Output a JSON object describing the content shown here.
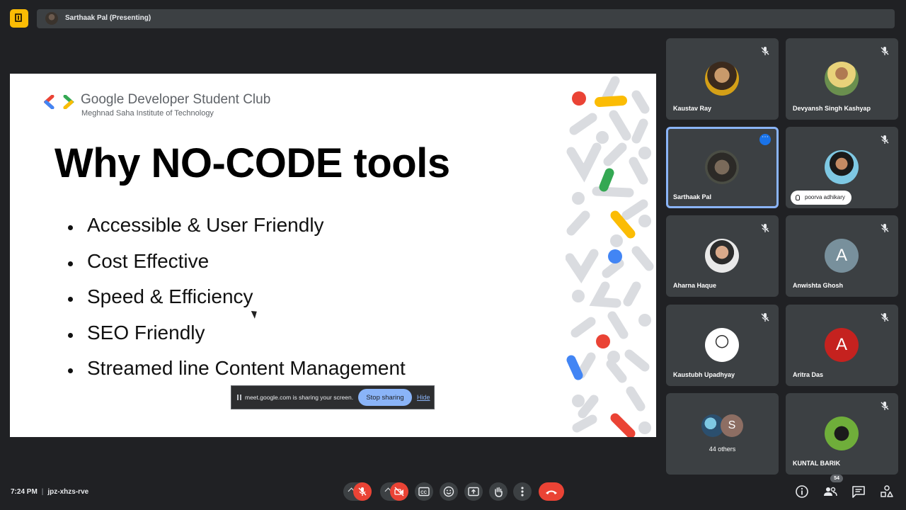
{
  "meeting": {
    "presenter_label": "Sarthaak Pal (Presenting)",
    "time": "7:24 PM",
    "separator": "|",
    "code": "jpz-xhzs-rve",
    "participant_count": "54"
  },
  "slide": {
    "org_name": "Google Developer Student Club",
    "org_institute": "Meghnad Saha Institute of Technology",
    "title": "Why NO-CODE tools",
    "bullets": [
      "Accessible & User Friendly",
      "Cost Effective",
      "Speed & Efficiency",
      "SEO Friendly",
      "Streamed line Content Management"
    ]
  },
  "share_bar": {
    "message": "meet.google.com is sharing your screen.",
    "stop_label": "Stop sharing",
    "hide_label": "Hide"
  },
  "participants": [
    {
      "name": "Kaustav Ray",
      "muted": true
    },
    {
      "name": "Devyansh Singh Kashyap",
      "muted": true
    },
    {
      "name": "Sarthaak Pal",
      "active": true
    },
    {
      "name": "poorva adhikary",
      "muted": true,
      "hand_raised": true
    },
    {
      "name": "Aharna Haque",
      "muted": true
    },
    {
      "name": "Anwishta Ghosh",
      "initial": "A",
      "avatar_color": "#78909c",
      "muted": true
    },
    {
      "name": "Kaustubh Upadhyay",
      "muted": true
    },
    {
      "name": "Aritra Das",
      "initial": "A",
      "avatar_color": "#c5221f",
      "muted": true
    },
    {
      "others_label": "44 others",
      "initial": "S",
      "avatar_color": "#8d6e63"
    },
    {
      "name": "KUNTAL BARIK",
      "muted": true
    }
  ],
  "colors": {
    "background": "#202124",
    "tile": "#3c4043",
    "accent_blue": "#8ab4f8",
    "danger_red": "#ea4335",
    "google_red": "#ea4335",
    "google_yellow": "#fbbc04",
    "google_green": "#34a853",
    "google_blue": "#4285f4"
  }
}
